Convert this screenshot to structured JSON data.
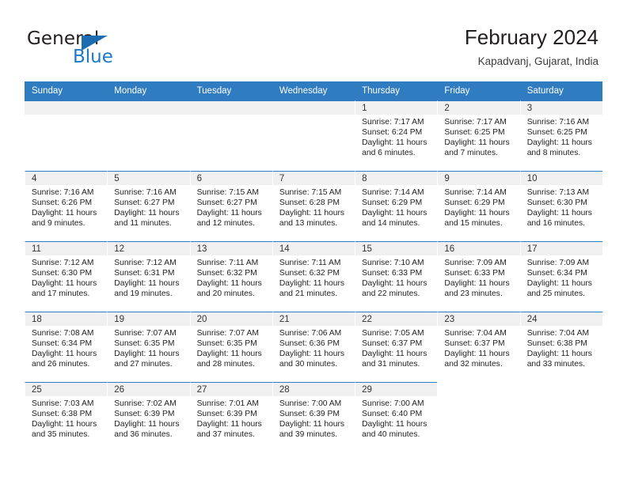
{
  "brand": {
    "name_part1": "General",
    "name_part2": "Blue",
    "triangle_color": "#1b6cb0",
    "blue_color": "#1b7ac7"
  },
  "header": {
    "title": "February 2024",
    "subtitle": "Kapadvanj, Gujarat, India"
  },
  "theme": {
    "header_bg": "#2f7cc0",
    "daynum_bg": "#f0f0f0",
    "grid_line": "#2f7cc0"
  },
  "weekday_headers": [
    "Sunday",
    "Monday",
    "Tuesday",
    "Wednesday",
    "Thursday",
    "Friday",
    "Saturday"
  ],
  "weeks": [
    [
      {
        "day": "",
        "sunrise": "",
        "sunset": "",
        "daylight1": "",
        "daylight2": "",
        "state": "empty"
      },
      {
        "day": "",
        "sunrise": "",
        "sunset": "",
        "daylight1": "",
        "daylight2": "",
        "state": "empty"
      },
      {
        "day": "",
        "sunrise": "",
        "sunset": "",
        "daylight1": "",
        "daylight2": "",
        "state": "empty"
      },
      {
        "day": "",
        "sunrise": "",
        "sunset": "",
        "daylight1": "",
        "daylight2": "",
        "state": "empty"
      },
      {
        "day": "1",
        "sunrise": "Sunrise: 7:17 AM",
        "sunset": "Sunset: 6:24 PM",
        "daylight1": "Daylight: 11 hours",
        "daylight2": "and 6 minutes.",
        "state": "filled"
      },
      {
        "day": "2",
        "sunrise": "Sunrise: 7:17 AM",
        "sunset": "Sunset: 6:25 PM",
        "daylight1": "Daylight: 11 hours",
        "daylight2": "and 7 minutes.",
        "state": "filled"
      },
      {
        "day": "3",
        "sunrise": "Sunrise: 7:16 AM",
        "sunset": "Sunset: 6:25 PM",
        "daylight1": "Daylight: 11 hours",
        "daylight2": "and 8 minutes.",
        "state": "filled"
      }
    ],
    [
      {
        "day": "4",
        "sunrise": "Sunrise: 7:16 AM",
        "sunset": "Sunset: 6:26 PM",
        "daylight1": "Daylight: 11 hours",
        "daylight2": "and 9 minutes.",
        "state": "filled"
      },
      {
        "day": "5",
        "sunrise": "Sunrise: 7:16 AM",
        "sunset": "Sunset: 6:27 PM",
        "daylight1": "Daylight: 11 hours",
        "daylight2": "and 11 minutes.",
        "state": "filled"
      },
      {
        "day": "6",
        "sunrise": "Sunrise: 7:15 AM",
        "sunset": "Sunset: 6:27 PM",
        "daylight1": "Daylight: 11 hours",
        "daylight2": "and 12 minutes.",
        "state": "filled"
      },
      {
        "day": "7",
        "sunrise": "Sunrise: 7:15 AM",
        "sunset": "Sunset: 6:28 PM",
        "daylight1": "Daylight: 11 hours",
        "daylight2": "and 13 minutes.",
        "state": "filled"
      },
      {
        "day": "8",
        "sunrise": "Sunrise: 7:14 AM",
        "sunset": "Sunset: 6:29 PM",
        "daylight1": "Daylight: 11 hours",
        "daylight2": "and 14 minutes.",
        "state": "filled"
      },
      {
        "day": "9",
        "sunrise": "Sunrise: 7:14 AM",
        "sunset": "Sunset: 6:29 PM",
        "daylight1": "Daylight: 11 hours",
        "daylight2": "and 15 minutes.",
        "state": "filled"
      },
      {
        "day": "10",
        "sunrise": "Sunrise: 7:13 AM",
        "sunset": "Sunset: 6:30 PM",
        "daylight1": "Daylight: 11 hours",
        "daylight2": "and 16 minutes.",
        "state": "filled"
      }
    ],
    [
      {
        "day": "11",
        "sunrise": "Sunrise: 7:12 AM",
        "sunset": "Sunset: 6:30 PM",
        "daylight1": "Daylight: 11 hours",
        "daylight2": "and 17 minutes.",
        "state": "filled"
      },
      {
        "day": "12",
        "sunrise": "Sunrise: 7:12 AM",
        "sunset": "Sunset: 6:31 PM",
        "daylight1": "Daylight: 11 hours",
        "daylight2": "and 19 minutes.",
        "state": "filled"
      },
      {
        "day": "13",
        "sunrise": "Sunrise: 7:11 AM",
        "sunset": "Sunset: 6:32 PM",
        "daylight1": "Daylight: 11 hours",
        "daylight2": "and 20 minutes.",
        "state": "filled"
      },
      {
        "day": "14",
        "sunrise": "Sunrise: 7:11 AM",
        "sunset": "Sunset: 6:32 PM",
        "daylight1": "Daylight: 11 hours",
        "daylight2": "and 21 minutes.",
        "state": "filled"
      },
      {
        "day": "15",
        "sunrise": "Sunrise: 7:10 AM",
        "sunset": "Sunset: 6:33 PM",
        "daylight1": "Daylight: 11 hours",
        "daylight2": "and 22 minutes.",
        "state": "filled"
      },
      {
        "day": "16",
        "sunrise": "Sunrise: 7:09 AM",
        "sunset": "Sunset: 6:33 PM",
        "daylight1": "Daylight: 11 hours",
        "daylight2": "and 23 minutes.",
        "state": "filled"
      },
      {
        "day": "17",
        "sunrise": "Sunrise: 7:09 AM",
        "sunset": "Sunset: 6:34 PM",
        "daylight1": "Daylight: 11 hours",
        "daylight2": "and 25 minutes.",
        "state": "filled"
      }
    ],
    [
      {
        "day": "18",
        "sunrise": "Sunrise: 7:08 AM",
        "sunset": "Sunset: 6:34 PM",
        "daylight1": "Daylight: 11 hours",
        "daylight2": "and 26 minutes.",
        "state": "filled"
      },
      {
        "day": "19",
        "sunrise": "Sunrise: 7:07 AM",
        "sunset": "Sunset: 6:35 PM",
        "daylight1": "Daylight: 11 hours",
        "daylight2": "and 27 minutes.",
        "state": "filled"
      },
      {
        "day": "20",
        "sunrise": "Sunrise: 7:07 AM",
        "sunset": "Sunset: 6:35 PM",
        "daylight1": "Daylight: 11 hours",
        "daylight2": "and 28 minutes.",
        "state": "filled"
      },
      {
        "day": "21",
        "sunrise": "Sunrise: 7:06 AM",
        "sunset": "Sunset: 6:36 PM",
        "daylight1": "Daylight: 11 hours",
        "daylight2": "and 30 minutes.",
        "state": "filled"
      },
      {
        "day": "22",
        "sunrise": "Sunrise: 7:05 AM",
        "sunset": "Sunset: 6:37 PM",
        "daylight1": "Daylight: 11 hours",
        "daylight2": "and 31 minutes.",
        "state": "filled"
      },
      {
        "day": "23",
        "sunrise": "Sunrise: 7:04 AM",
        "sunset": "Sunset: 6:37 PM",
        "daylight1": "Daylight: 11 hours",
        "daylight2": "and 32 minutes.",
        "state": "filled"
      },
      {
        "day": "24",
        "sunrise": "Sunrise: 7:04 AM",
        "sunset": "Sunset: 6:38 PM",
        "daylight1": "Daylight: 11 hours",
        "daylight2": "and 33 minutes.",
        "state": "filled"
      }
    ],
    [
      {
        "day": "25",
        "sunrise": "Sunrise: 7:03 AM",
        "sunset": "Sunset: 6:38 PM",
        "daylight1": "Daylight: 11 hours",
        "daylight2": "and 35 minutes.",
        "state": "filled"
      },
      {
        "day": "26",
        "sunrise": "Sunrise: 7:02 AM",
        "sunset": "Sunset: 6:39 PM",
        "daylight1": "Daylight: 11 hours",
        "daylight2": "and 36 minutes.",
        "state": "filled"
      },
      {
        "day": "27",
        "sunrise": "Sunrise: 7:01 AM",
        "sunset": "Sunset: 6:39 PM",
        "daylight1": "Daylight: 11 hours",
        "daylight2": "and 37 minutes.",
        "state": "filled"
      },
      {
        "day": "28",
        "sunrise": "Sunrise: 7:00 AM",
        "sunset": "Sunset: 6:39 PM",
        "daylight1": "Daylight: 11 hours",
        "daylight2": "and 39 minutes.",
        "state": "filled"
      },
      {
        "day": "29",
        "sunrise": "Sunrise: 7:00 AM",
        "sunset": "Sunset: 6:40 PM",
        "daylight1": "Daylight: 11 hours",
        "daylight2": "and 40 minutes.",
        "state": "filled"
      },
      {
        "day": "",
        "sunrise": "",
        "sunset": "",
        "daylight1": "",
        "daylight2": "",
        "state": "blank"
      },
      {
        "day": "",
        "sunrise": "",
        "sunset": "",
        "daylight1": "",
        "daylight2": "",
        "state": "blank"
      }
    ]
  ]
}
